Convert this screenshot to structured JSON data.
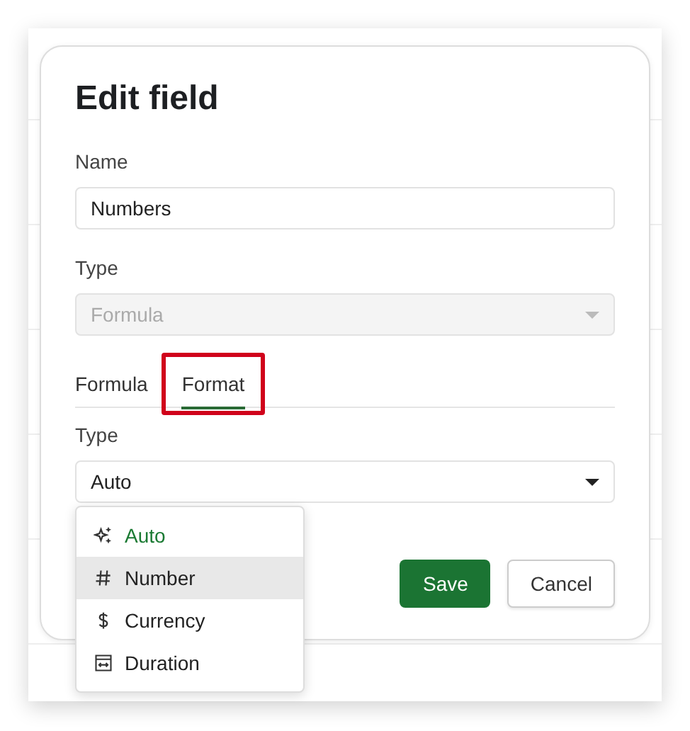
{
  "dialog": {
    "title": "Edit field",
    "name_field": {
      "label": "Name",
      "value": "Numbers"
    },
    "type_field": {
      "label": "Type",
      "value": "Formula",
      "disabled": true
    },
    "tabs": [
      {
        "label": "Formula",
        "selected": false,
        "highlighted": false
      },
      {
        "label": "Format",
        "selected": true,
        "highlighted": true
      }
    ],
    "format_type": {
      "label": "Type",
      "value": "Auto"
    },
    "menu": [
      {
        "kind": "auto",
        "label": "Auto",
        "selected": true,
        "hovered": false
      },
      {
        "kind": "number",
        "label": "Number",
        "selected": false,
        "hovered": true
      },
      {
        "kind": "currency",
        "label": "Currency",
        "selected": false,
        "hovered": false
      },
      {
        "kind": "duration",
        "label": "Duration",
        "selected": false,
        "hovered": false
      }
    ],
    "buttons": [
      {
        "kind": "primary",
        "label": "Save"
      },
      {
        "kind": "secondary",
        "label": "Cancel"
      }
    ]
  }
}
